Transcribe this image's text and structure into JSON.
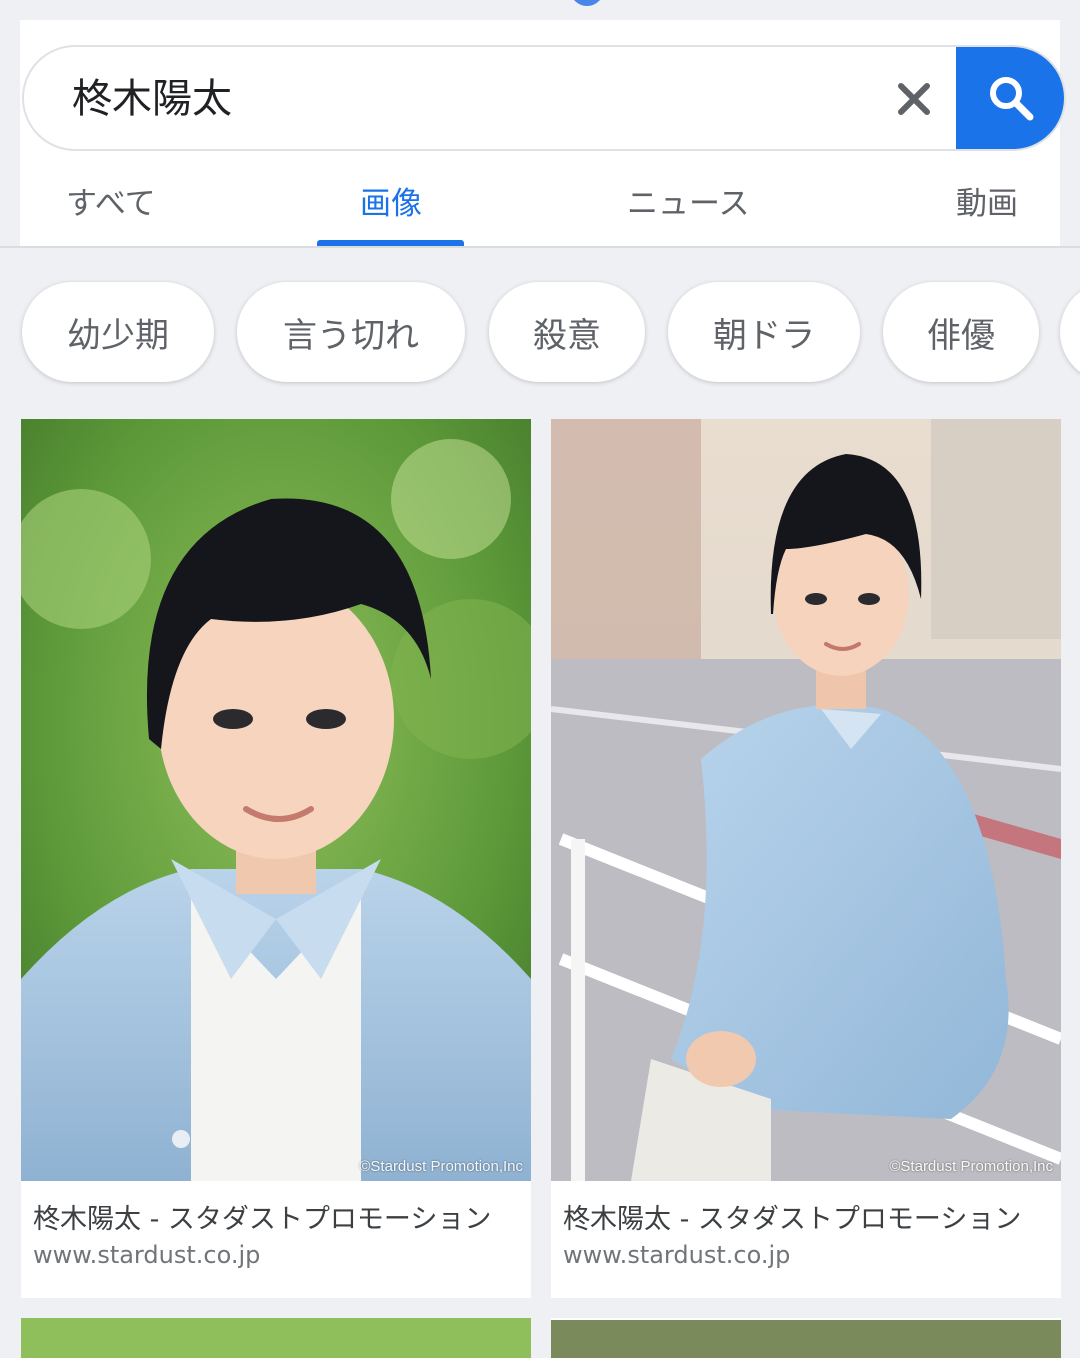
{
  "search": {
    "query": "柊木陽太",
    "clear_icon": "close-icon",
    "submit_icon": "search-icon"
  },
  "tabs": [
    {
      "label": "すべて",
      "active": false
    },
    {
      "label": "画像",
      "active": true
    },
    {
      "label": "ニュース",
      "active": false
    },
    {
      "label": "動画",
      "active": false
    }
  ],
  "chips": [
    {
      "label": "幼少期"
    },
    {
      "label": "言う切れ"
    },
    {
      "label": "殺意"
    },
    {
      "label": "朝ドラ"
    },
    {
      "label": "俳優"
    }
  ],
  "results": [
    {
      "title": "柊木陽太 - スタダストプロモーション",
      "domain": "www.stardust.co.jp",
      "watermark": "©Stardust Promotion,Inc"
    },
    {
      "title": "柊木陽太 - スタダストプロモーション",
      "domain": "www.stardust.co.jp",
      "watermark": "©Stardust Promotion,Inc"
    }
  ],
  "colors": {
    "accent": "#1a73e8",
    "background": "#eef0f3",
    "chip_text": "#5f6368"
  }
}
